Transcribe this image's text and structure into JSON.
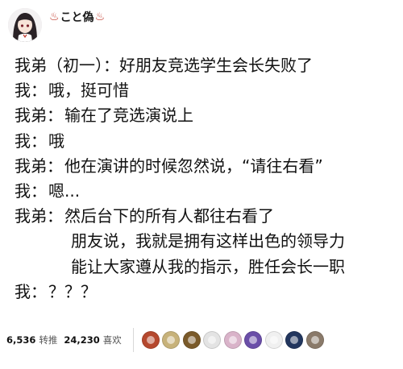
{
  "post": {
    "author": {
      "name": "こと偽",
      "spring_icon_left": "♨",
      "spring_icon_right": "♨",
      "avatar": "anime-girl-avatar"
    },
    "lines": [
      {
        "speaker": "我弟",
        "colon": "：",
        "text": "（初一）：好朋友竞选学生会长失败了"
      },
      {
        "speaker": "我",
        "colon": "：",
        "text": "哦，挺可惜"
      },
      {
        "speaker": "我弟",
        "colon": "：",
        "text": "输在了竞选演说上"
      },
      {
        "speaker": "我",
        "colon": "：",
        "text": "哦"
      },
      {
        "speaker": "我弟",
        "colon": "：",
        "text": "他在演讲的时候忽然说，“请往右看”"
      },
      {
        "speaker": "我",
        "colon": "：",
        "text": "嗯..."
      },
      {
        "speaker": "我弟",
        "colon": "：",
        "text": "然后台下的所有人都往右看了"
      },
      {
        "speaker": "",
        "colon": "",
        "text": "朋友说，我就是拥有这样出色的领导力"
      },
      {
        "speaker": "",
        "colon": "",
        "text": "能让大家遵从我的指示，胜任会长一职"
      },
      {
        "speaker": "我",
        "colon": "：",
        "text": "？？？"
      }
    ]
  },
  "stats": {
    "reposts_count": "6,536",
    "reposts_label": "转推",
    "likes_count": "24,230",
    "likes_label": "喜欢"
  },
  "likers": [
    {
      "name": "liker-avatar-1",
      "color": "#b5482e"
    },
    {
      "name": "liker-avatar-2",
      "color": "#c7b27a"
    },
    {
      "name": "liker-avatar-3",
      "color": "#7a5a2a"
    },
    {
      "name": "liker-avatar-4",
      "color": "#e3e3e3"
    },
    {
      "name": "liker-avatar-5",
      "color": "#d9b3c9"
    },
    {
      "name": "liker-avatar-6",
      "color": "#6a4ea8"
    },
    {
      "name": "liker-avatar-7",
      "color": "#f0f0f0"
    },
    {
      "name": "liker-avatar-8",
      "color": "#22365e"
    },
    {
      "name": "liker-avatar-9",
      "color": "#8a7a6a"
    }
  ]
}
